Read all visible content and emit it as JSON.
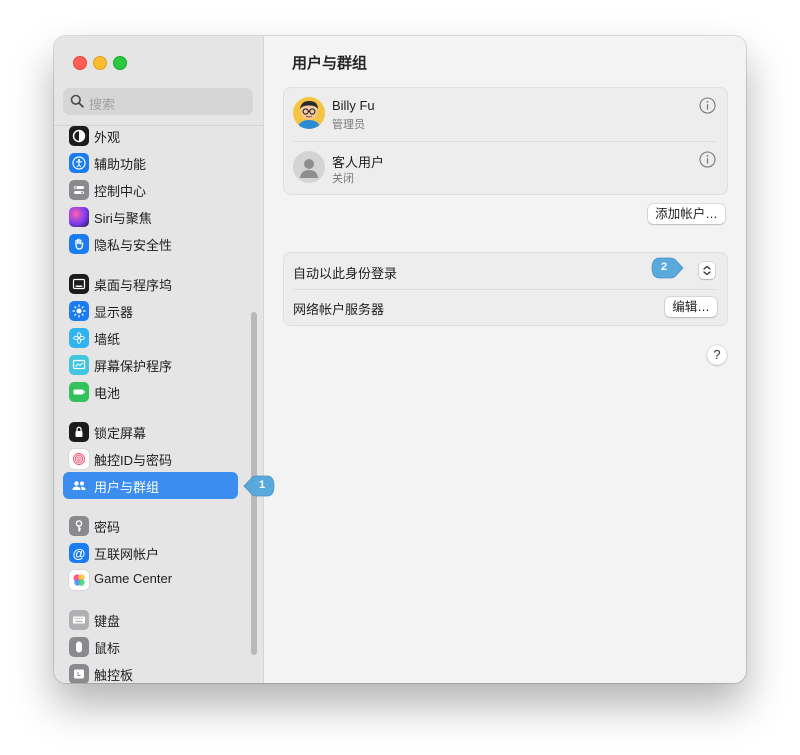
{
  "search": {
    "placeholder": "搜索"
  },
  "sidebar": {
    "items": [
      {
        "label": "外观",
        "icon": "appearance-icon"
      },
      {
        "label": "辅助功能",
        "icon": "accessibility-icon"
      },
      {
        "label": "控制中心",
        "icon": "control-center-icon"
      },
      {
        "label": "Siri与聚焦",
        "icon": "siri-icon"
      },
      {
        "label": "隐私与安全性",
        "icon": "privacy-hand-icon"
      },
      {
        "label": "桌面与程序坞",
        "icon": "desktop-dock-icon"
      },
      {
        "label": "显示器",
        "icon": "display-sun-icon"
      },
      {
        "label": "墙纸",
        "icon": "wallpaper-icon"
      },
      {
        "label": "屏幕保护程序",
        "icon": "screensaver-icon"
      },
      {
        "label": "电池",
        "icon": "battery-icon"
      },
      {
        "label": "锁定屏幕",
        "icon": "lock-icon"
      },
      {
        "label": "触控ID与密码",
        "icon": "fingerprint-icon"
      },
      {
        "label": "用户与群组",
        "icon": "users-icon",
        "selected": true
      },
      {
        "label": "密码",
        "icon": "key-icon"
      },
      {
        "label": "互联网帐户",
        "icon": "at-sign-icon"
      },
      {
        "label": "Game Center",
        "icon": "game-center-icon"
      },
      {
        "label": "键盘",
        "icon": "keyboard-icon"
      },
      {
        "label": "鼠标",
        "icon": "mouse-icon"
      },
      {
        "label": "触控板",
        "icon": "trackpad-icon"
      }
    ]
  },
  "callouts": {
    "first": "1",
    "second": "2"
  },
  "main": {
    "title": "用户与群组",
    "users": [
      {
        "name": "Billy Fu",
        "role": "管理员"
      },
      {
        "name": "客人用户",
        "role": "关闭"
      }
    ],
    "add_account_label": "添加帐户…",
    "auto_login_label": "自动以此身份登录",
    "network_server_label": "网络帐户服务器",
    "edit_label": "编辑…",
    "help_label": "?"
  },
  "colors": {
    "accent": "#3b8df0",
    "callout": "#5aa9dc"
  }
}
